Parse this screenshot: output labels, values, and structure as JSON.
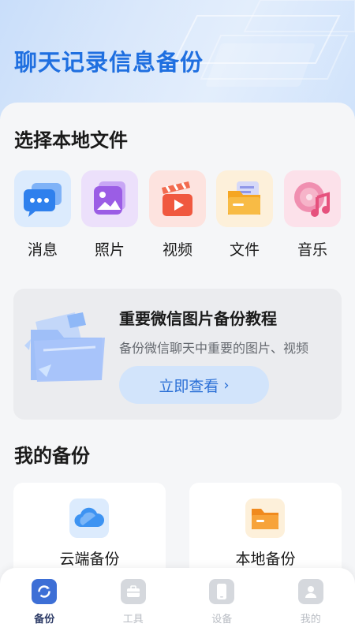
{
  "hero": {
    "title": "聊天记录信息备份"
  },
  "local_files": {
    "title": "选择本地文件",
    "items": [
      {
        "label": "消息",
        "icon": "chat-bubble-icon",
        "color": "#3b86f0"
      },
      {
        "label": "照片",
        "icon": "photo-icon",
        "color": "#9b63e8"
      },
      {
        "label": "视频",
        "icon": "video-clapper-icon",
        "color": "#f0583f"
      },
      {
        "label": "文件",
        "icon": "folder-icon",
        "color": "#f59a2b"
      },
      {
        "label": "音乐",
        "icon": "music-disc-icon",
        "color": "#e6517d"
      }
    ]
  },
  "promo": {
    "title": "重要微信图片备份教程",
    "description": "备份微信聊天中重要的图片、视频",
    "button_label": "立即查看",
    "accent": "#2a6fd6"
  },
  "my_backups": {
    "title": "我的备份",
    "items": [
      {
        "label": "云端备份",
        "icon": "cloud-icon"
      },
      {
        "label": "本地备份",
        "icon": "folder-icon"
      }
    ]
  },
  "tabbar": {
    "items": [
      {
        "label": "备份",
        "icon": "backup-sync-icon",
        "active": true
      },
      {
        "label": "工具",
        "icon": "toolbox-icon",
        "active": false
      },
      {
        "label": "设备",
        "icon": "phone-device-icon",
        "active": false
      },
      {
        "label": "我的",
        "icon": "user-profile-icon",
        "active": false
      }
    ]
  }
}
